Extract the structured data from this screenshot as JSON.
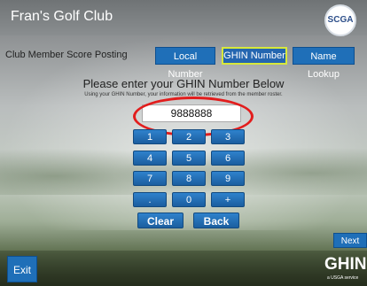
{
  "header": {
    "club_name": "Fran's Golf Club",
    "logo_text": "SCGA"
  },
  "posting_label": "Club Member Score Posting",
  "tabs": [
    {
      "label": "Local Number",
      "active": false
    },
    {
      "label": "GHIN Number",
      "active": true
    },
    {
      "label": "Name Lookup",
      "active": false
    }
  ],
  "prompt": "Please enter your GHIN Number Below",
  "subprompt": "Using your GHIN Number, your information will be retrieved from the member roster.",
  "entry_value": "9888888",
  "keypad": {
    "keys": [
      "1",
      "2",
      "3",
      "4",
      "5",
      "6",
      "7",
      "8",
      "9",
      ".",
      "0",
      "+"
    ],
    "clear": "Clear",
    "back": "Back"
  },
  "next_label": "Next",
  "exit_label": "Exit",
  "footer": {
    "ghin_logo": "GHIN",
    "ghin_sub": "a USGA service"
  },
  "colors": {
    "button": "#1f6fb8",
    "active_outline": "#d8e83a",
    "annotation": "#e21d1d"
  }
}
